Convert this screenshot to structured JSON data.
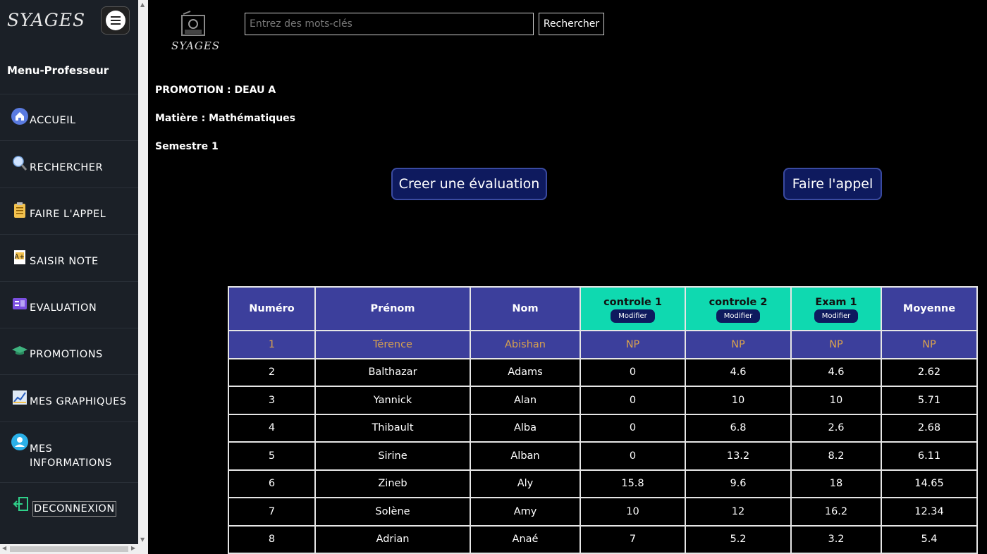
{
  "sidebar": {
    "brand": "SYAGES",
    "menu_title": "Menu-Professeur",
    "items": [
      {
        "label": "ACCUEIL",
        "icon": "home-icon"
      },
      {
        "label": "RECHERCHER",
        "icon": "search-icon"
      },
      {
        "label": "FAIRE L'APPEL",
        "icon": "clipboard-icon"
      },
      {
        "label": "SAISIR NOTE",
        "icon": "grade-icon"
      },
      {
        "label": "EVALUATION",
        "icon": "evaluation-icon"
      },
      {
        "label": "PROMOTIONS",
        "icon": "graduation-cap-icon"
      },
      {
        "label": "MES GRAPHIQUES",
        "icon": "chart-icon"
      },
      {
        "label": "MES INFORMATIONS",
        "icon": "user-icon"
      },
      {
        "label": "DECONNEXION",
        "icon": "logout-icon"
      }
    ]
  },
  "header": {
    "logo_text": "SYAGES",
    "search_placeholder": "Entrez des mots-clés",
    "search_button": "Rechercher"
  },
  "info": {
    "promotion": "PROMOTION : DEAU A",
    "matiere": "Matière : Mathématiques",
    "semestre": "Semestre 1"
  },
  "actions": {
    "create_eval": "Creer une évaluation",
    "call": "Faire l'appel"
  },
  "table": {
    "headers": [
      "Numéro",
      "Prénom",
      "Nom",
      "controle 1",
      "controle 2",
      "Exam 1",
      "Moyenne"
    ],
    "modify_label": "Modifier",
    "rows": [
      [
        "1",
        "Térence",
        "Abishan",
        "NP",
        "NP",
        "NP",
        "NP"
      ],
      [
        "2",
        "Balthazar",
        "Adams",
        "0",
        "4.6",
        "4.6",
        "2.62"
      ],
      [
        "3",
        "Yannick",
        "Alan",
        "0",
        "10",
        "10",
        "5.71"
      ],
      [
        "4",
        "Thibault",
        "Alba",
        "0",
        "6.8",
        "2.6",
        "2.68"
      ],
      [
        "5",
        "Sirine",
        "Alban",
        "0",
        "13.2",
        "8.2",
        "6.11"
      ],
      [
        "6",
        "Zineb",
        "Aly",
        "15.8",
        "9.6",
        "18",
        "14.65"
      ],
      [
        "7",
        "Solène",
        "Amy",
        "10",
        "12",
        "16.2",
        "12.34"
      ],
      [
        "8",
        "Adrian",
        "Anaé",
        "7",
        "5.2",
        "3.2",
        "5.4"
      ]
    ]
  },
  "colors": {
    "header_bg": "#3c3f9c",
    "eval_header_bg": "#0fd9b0",
    "button_bg": "#0e1a5e",
    "highlight_text": "#d8a14e"
  }
}
